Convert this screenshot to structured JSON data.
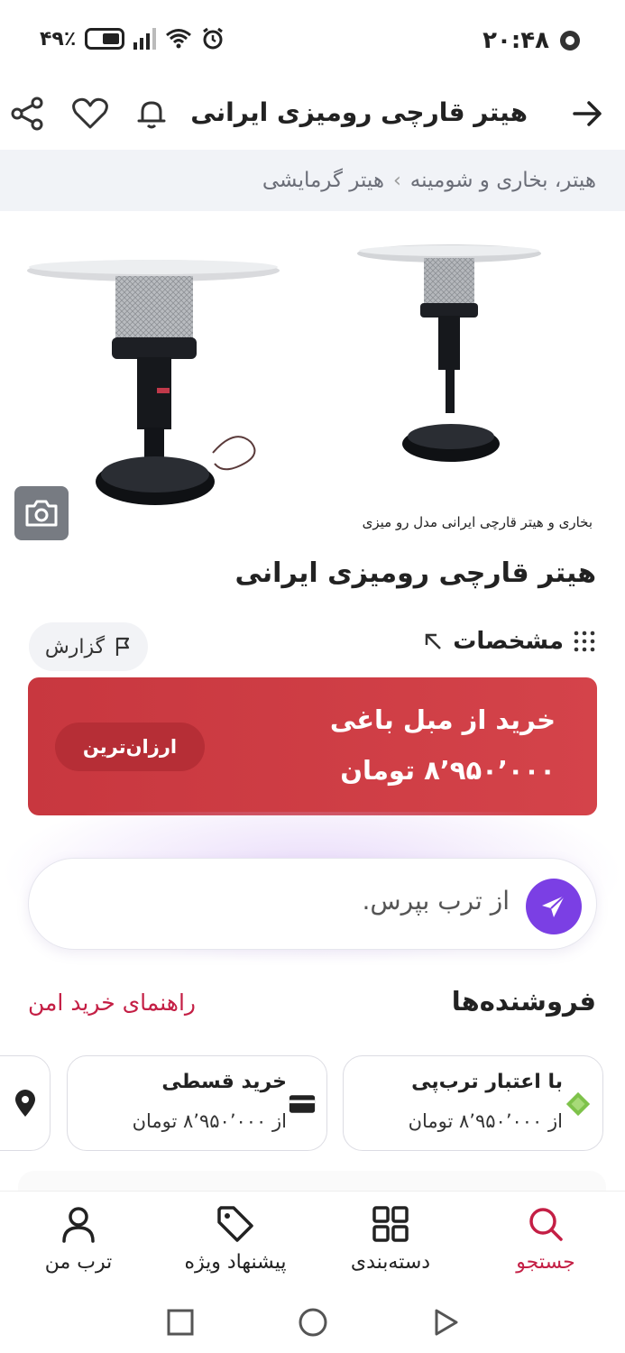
{
  "status": {
    "time": "۲۰:۴۸",
    "battery": "۴۹٪"
  },
  "appbar": {
    "title": "هیتر قارچی رومیزی ایرانی"
  },
  "breadcrumb": {
    "items": [
      "هیتر، بخاری و شومینه",
      "هیتر گرمایشی"
    ],
    "separator": "›"
  },
  "gallery": {
    "caption": "بخاری و هیتر قارچی ایرانی مدل رو میزی"
  },
  "product": {
    "title": "هیتر قارچی رومیزی ایرانی",
    "specs_label": "مشخصات",
    "report_label": "گزارش"
  },
  "buy": {
    "title": "خرید از مبل باغی",
    "price": "۸٬۹۵۰٬۰۰۰ تومان",
    "badge": "ارزان‌ترین"
  },
  "ask": {
    "placeholder": "از ترب بپرس."
  },
  "sellers": {
    "title": "فروشنده‌ها",
    "guide": "راهنمای خرید امن",
    "chips": [
      {
        "line1": "با اعتبار ترب‌پی",
        "line2": "از ۸٬۹۵۰٬۰۰۰ تومان"
      },
      {
        "line1": "خرید قسطی",
        "line2": "از ۸٬۹۵۰٬۰۰۰ تومان"
      }
    ]
  },
  "bottomnav": {
    "items": [
      "جستجو",
      "دسته‌بندی",
      "پیشنهاد ویژه",
      "ترب من"
    ]
  },
  "colors": {
    "accent": "#c41f45",
    "buy_card": "#d0404a",
    "send_button": "#7b3fe4",
    "torobpay_green": "#7ec24a"
  }
}
